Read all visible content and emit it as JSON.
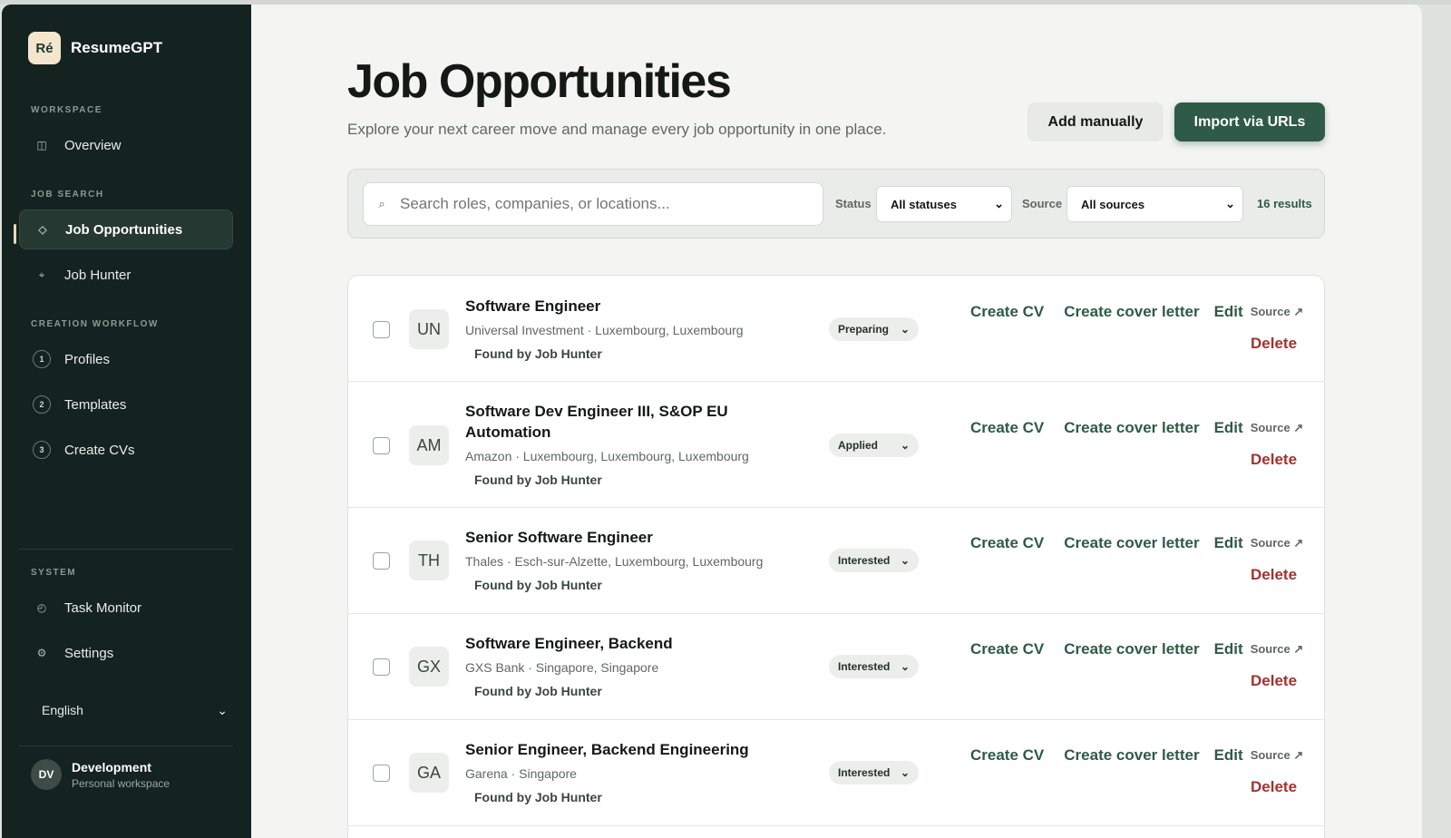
{
  "app": {
    "logo_text": "Ré",
    "name": "ResumeGPT"
  },
  "sidebar": {
    "workspace_label": "WORKSPACE",
    "overview": {
      "label": "Overview",
      "icon": "grid-icon"
    },
    "job_search_label": "JOB SEARCH",
    "job_opportunities": {
      "label": "Job Opportunities",
      "icon": "diamond-icon"
    },
    "job_hunter": {
      "label": "Job Hunter",
      "icon": "crosshair-icon"
    },
    "creation_label": "CREATION WORKFLOW",
    "steps": [
      {
        "num": "1",
        "label": "Profiles"
      },
      {
        "num": "2",
        "label": "Templates"
      },
      {
        "num": "3",
        "label": "Create CVs"
      }
    ],
    "system_label": "SYSTEM",
    "task_monitor": {
      "label": "Task Monitor",
      "icon": "clock-icon"
    },
    "settings": {
      "label": "Settings",
      "icon": "gear-icon"
    },
    "language": "English",
    "user": {
      "initials": "DV",
      "name": "Development",
      "sub": "Personal workspace"
    }
  },
  "header": {
    "title": "Job Opportunities",
    "subtitle": "Explore your next career move and manage every job opportunity in one place.",
    "add_manually": "Add manually",
    "import_urls": "Import via URLs"
  },
  "filters": {
    "search_placeholder": "Search roles, companies, or locations...",
    "status_label": "Status",
    "status_value": "All statuses",
    "source_label": "Source",
    "source_value": "All sources",
    "results": "16 results"
  },
  "actions": {
    "create_cv": "Create CV",
    "create_cover": "Create cover letter",
    "edit": "Edit",
    "source": "Source ↗",
    "delete": "Delete",
    "found_by": "Found by Job Hunter"
  },
  "jobs": [
    {
      "initials": "UN",
      "title": "Software Engineer",
      "meta": "Universal Investment · Luxembourg, Luxembourg",
      "status": "Preparing"
    },
    {
      "initials": "AM",
      "title": "Software Dev Engineer III, S&OP EU Automation",
      "meta": "Amazon · Luxembourg, Luxembourg, Luxembourg",
      "status": "Applied"
    },
    {
      "initials": "TH",
      "title": "Senior Software Engineer",
      "meta": "Thales · Esch-sur-Alzette, Luxembourg, Luxembourg",
      "status": "Interested"
    },
    {
      "initials": "GX",
      "title": "Software Engineer, Backend",
      "meta": "GXS Bank · Singapore, Singapore",
      "status": "Interested"
    },
    {
      "initials": "GA",
      "title": "Senior Engineer, Backend Engineering",
      "meta": "Garena · Singapore",
      "status": "Interested"
    }
  ]
}
